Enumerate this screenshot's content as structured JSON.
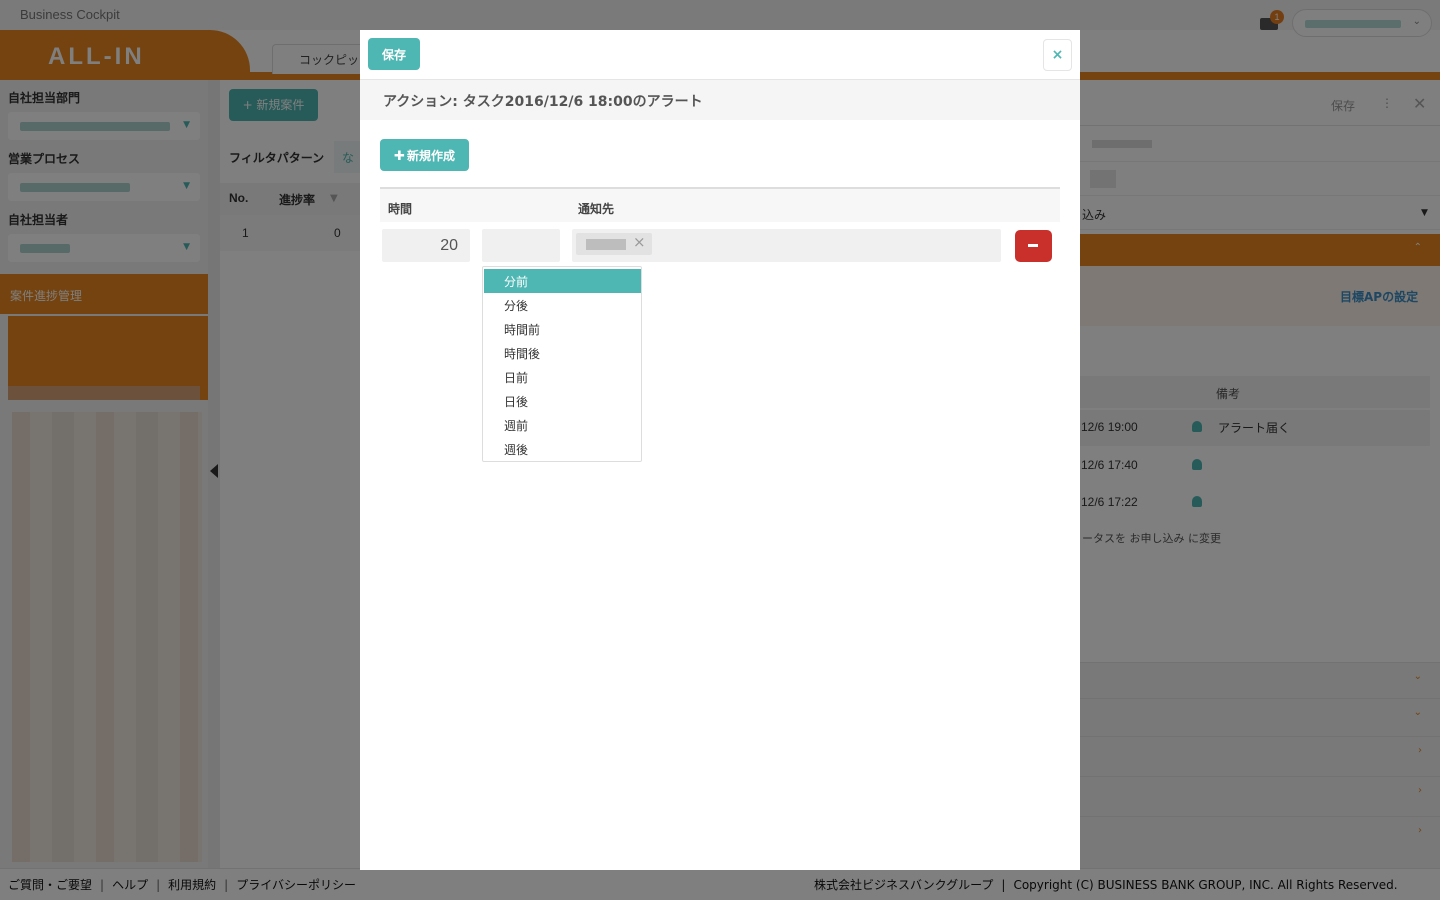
{
  "app": {
    "name": "Business Cockpit",
    "logo": "ALL-IN",
    "notification_count": "1",
    "nav_tab": "コックピッ"
  },
  "sidebar": {
    "department_label": "自社担当部門",
    "process_label": "営業プロセス",
    "person_label": "自社担当者",
    "section_label": "案件進捗管理"
  },
  "main": {
    "new_case_button": "+ 新規案件",
    "filter_label": "フィルタパターン",
    "filter_value": "な",
    "table": {
      "headers": [
        "No.",
        "進捗率"
      ],
      "rows": [
        [
          "1",
          "0"
        ]
      ]
    }
  },
  "right_panel": {
    "save": "保存",
    "status": "込み",
    "ap_link": "目標APの設定",
    "remarks_header": "備考",
    "alerts": [
      {
        "time": "12/6 19:00",
        "note": "アラート届く"
      },
      {
        "time": "12/6 17:40",
        "note": ""
      },
      {
        "time": "12/6 17:22",
        "note": ""
      }
    ],
    "log_text": "ータスを お申し込み に変更"
  },
  "modal": {
    "save_label": "保存",
    "close_label": "×",
    "title": "アクション: タスク2016/12/6 18:00のアラート",
    "new_button": "新規作成",
    "columns": {
      "time": "時間",
      "notify": "通知先"
    },
    "row": {
      "time_value": "20"
    },
    "unit_options": [
      "分前",
      "分後",
      "時間前",
      "時間後",
      "日前",
      "日後",
      "週前",
      "週後"
    ],
    "selected_unit_index": 0
  },
  "footer": {
    "links": [
      "ご質問・ご要望",
      "ヘルプ",
      "利用規約",
      "プライバシーポリシー"
    ],
    "company": "株式会社ビジネスバンクグループ",
    "copyright": "Copyright (C) BUSINESS BANK GROUP, INC. All Rights Reserved."
  },
  "colors": {
    "accent": "#4fb7b3",
    "brand_orange": "#e8871e",
    "danger": "#c9302c"
  }
}
